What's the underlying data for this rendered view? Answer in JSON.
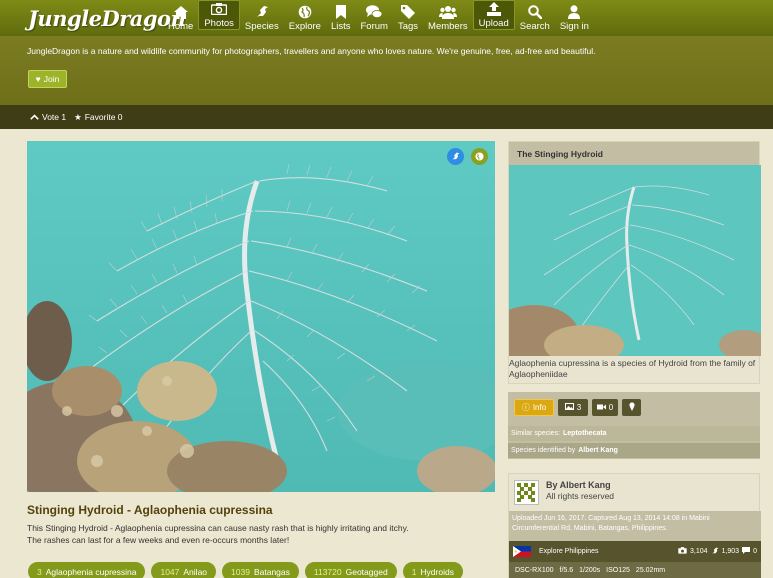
{
  "nav": {
    "logo": "JungleDragon",
    "items": [
      {
        "label": "Home",
        "icon": "home-icon"
      },
      {
        "label": "Photos",
        "icon": "camera-icon"
      },
      {
        "label": "Species",
        "icon": "bird-icon"
      },
      {
        "label": "Explore",
        "icon": "globe-icon"
      },
      {
        "label": "Lists",
        "icon": "bookmark-icon"
      },
      {
        "label": "Forum",
        "icon": "chat-icon"
      },
      {
        "label": "Tags",
        "icon": "tag-icon"
      },
      {
        "label": "Members",
        "icon": "users-icon"
      },
      {
        "label": "Upload",
        "icon": "upload-icon"
      },
      {
        "label": "Search",
        "icon": "search-icon"
      },
      {
        "label": "Sign in",
        "icon": "user-icon"
      }
    ],
    "active": "Photos"
  },
  "hero": {
    "intro": "JungleDragon is a nature and wildlife community for photographers, travellers and anyone who loves nature. We're genuine, free, ad-free and beautiful.",
    "join_label": "Join"
  },
  "votebar": {
    "vote": "Vote 1",
    "favorite": "Favorite 0"
  },
  "photo": {
    "title": "Stinging Hydroid - Aglaophenia cupressina",
    "desc_1": "This Stinging Hydroid - Aglaophenia cupressina can cause nasty rash that is highly irritating and itchy.",
    "desc_2": "The rashes can last for a few weeks and even re-occurs months later!"
  },
  "tags": [
    {
      "count": "3",
      "label": "Aglaophenia cupressina"
    },
    {
      "count": "1047",
      "label": "Anilao"
    },
    {
      "count": "1039",
      "label": "Batangas"
    },
    {
      "count": "113720",
      "label": "Geotagged"
    },
    {
      "count": "1",
      "label": "Hydroids"
    }
  ],
  "species_box": {
    "title": "The Stinging Hydroid",
    "caption": "Aglaophenia cupressina is a species of Hydroid from the family of Aglaopheniidae",
    "info_label": "Info",
    "photos_count": "3",
    "videos_count": "0",
    "similar_label": "Similar species:",
    "similar_value": "Leptothecata",
    "identified_label": "Species identified by",
    "identified_value": "Albert Kang"
  },
  "author_box": {
    "by": "By Albert Kang",
    "rights": "All rights reserved",
    "meta": "Uploaded Jun 16, 2017. Captured Aug 13, 2014 14:08 in Mabini Circumferential Rd, Mabini, Batangas, Philippines.",
    "explore": "Explore Philippines",
    "views": "3,104",
    "likes": "1,903",
    "comments": "0",
    "camera": "DSC-RX100",
    "aperture": "f/5.6",
    "shutter": "1/200s",
    "iso": "ISO125",
    "focal": "25.02mm"
  },
  "colors": {
    "nav": "#6f7b12",
    "hero": "#76761c",
    "votebar": "#3f3d15",
    "tag": "#839a1b",
    "title": "#54420c",
    "info_button": "#dba812"
  }
}
